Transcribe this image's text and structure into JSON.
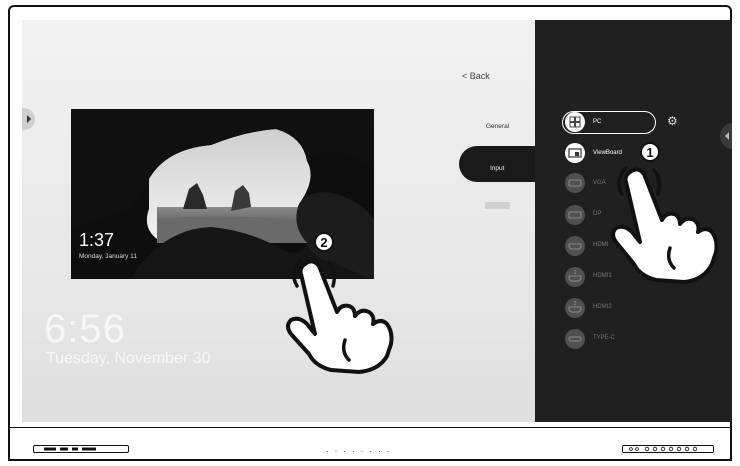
{
  "menu": {
    "back": "< Back",
    "general": "General",
    "input": "Input"
  },
  "sources": [
    {
      "name": "PC",
      "active": true
    },
    {
      "name": "ViewBoard",
      "active": true
    },
    {
      "name": "VGA",
      "active": false
    },
    {
      "name": "DP",
      "active": false
    },
    {
      "name": "HDMI",
      "active": false
    },
    {
      "name": "HDMI1",
      "active": false
    },
    {
      "name": "HDMI2",
      "active": false
    },
    {
      "name": "TYPE-C",
      "active": false
    }
  ],
  "preview": {
    "clock": "1:37",
    "date": "Monday, January 11"
  },
  "desktop": {
    "clock": "6:56",
    "date": "Tuesday, November 30"
  },
  "callouts": {
    "one": "1",
    "two": "2"
  },
  "icons": [
    "settings-gear-icon",
    "pointing-hand-icon",
    "pc-windows-icon",
    "viewboard-icon",
    "vga-port-icon",
    "displayport-icon",
    "hdmi-port-icon",
    "type-c-port-icon"
  ]
}
